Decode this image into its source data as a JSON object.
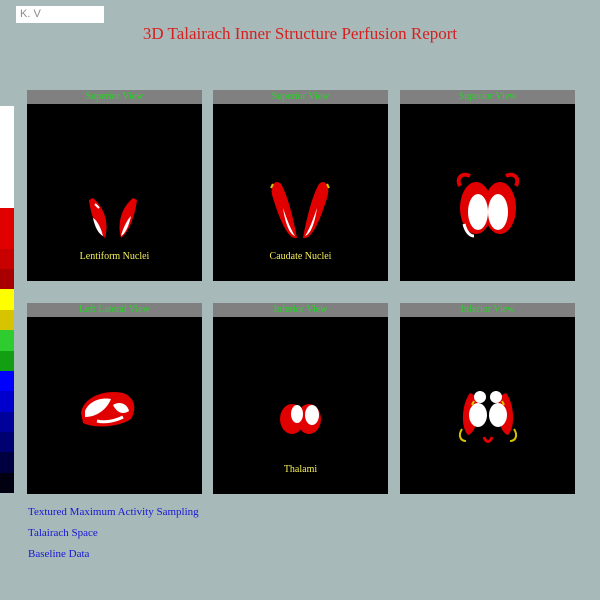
{
  "header": {
    "name_field_value": "K. V",
    "title": "3D Talairach Inner Structure Perfusion Report",
    "title_color": "#d61f1f"
  },
  "color_scale": {
    "bands": [
      "#ffffff",
      "#ffffff",
      "#ffffff",
      "#ffffff",
      "#ffffff",
      "#e00000",
      "#e00000",
      "#c80000",
      "#a80000",
      "#ffff00",
      "#d6c400",
      "#2ecc2e",
      "#12a012",
      "#0000ff",
      "#0000cc",
      "#00009a",
      "#000070",
      "#000040",
      "#000010"
    ]
  },
  "panels": [
    {
      "header": "Superior View",
      "caption": "Lentiform Nuclei",
      "icon": "lentiform-nuclei-superior-render"
    },
    {
      "header": "Superior View",
      "caption": "Caudate Nuclei",
      "icon": "caudate-nuclei-superior-render"
    },
    {
      "header": "Superior View",
      "caption": "",
      "icon": "combined-structures-superior-render"
    },
    {
      "header": "Left Lateral View",
      "caption": "",
      "icon": "combined-structures-lateral-render"
    },
    {
      "header": "Inferior View",
      "caption": "Thalami",
      "icon": "thalami-inferior-render"
    },
    {
      "header": "Inferior View",
      "caption": "",
      "icon": "combined-structures-inferior-render"
    }
  ],
  "footer": {
    "link1": "Textured Maximum Activity Sampling",
    "link2": "Talairach Space",
    "link3": "Baseline Data"
  },
  "colors": {
    "background": "#a7b9b9",
    "panel_header": "#808080",
    "panel_header_text": "#2bd12b",
    "caption": "#f4ef5a",
    "link": "#1616d6"
  }
}
